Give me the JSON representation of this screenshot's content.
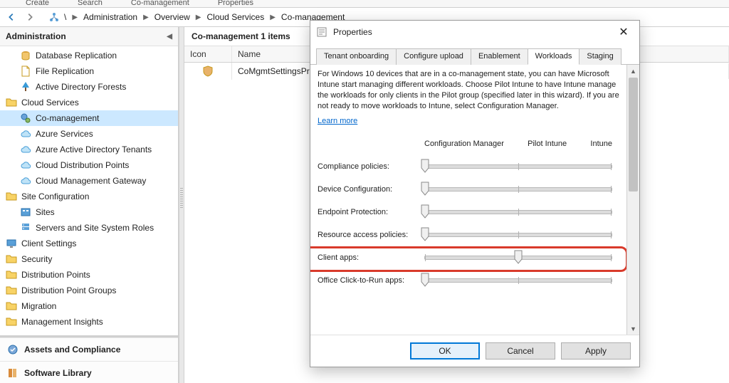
{
  "ribbon": {
    "items": [
      "Create",
      "Search",
      "Co-management",
      "Properties"
    ]
  },
  "breadcrumb": {
    "root_sep": "\\",
    "nodes": [
      "Administration",
      "Overview",
      "Cloud Services",
      "Co-management"
    ]
  },
  "nav": {
    "header": "Administration",
    "tree": [
      {
        "icon": "db-repl",
        "label": "Database Replication",
        "indent": 1
      },
      {
        "icon": "file-repl",
        "label": "File Replication",
        "indent": 1
      },
      {
        "icon": "ad-forests",
        "label": "Active Directory Forests",
        "indent": 1
      },
      {
        "icon": "folder",
        "label": "Cloud Services",
        "indent": 0
      },
      {
        "icon": "co-mgmt",
        "label": "Co-management",
        "indent": 1,
        "selected": true
      },
      {
        "icon": "azure",
        "label": "Azure Services",
        "indent": 1
      },
      {
        "icon": "aad-tenant",
        "label": "Azure Active Directory Tenants",
        "indent": 1
      },
      {
        "icon": "cdp",
        "label": "Cloud Distribution Points",
        "indent": 1
      },
      {
        "icon": "cmg",
        "label": "Cloud Management Gateway",
        "indent": 1
      },
      {
        "icon": "folder",
        "label": "Site Configuration",
        "indent": 0
      },
      {
        "icon": "sites",
        "label": "Sites",
        "indent": 1
      },
      {
        "icon": "servers",
        "label": "Servers and Site System Roles",
        "indent": 1
      },
      {
        "icon": "client",
        "label": "Client Settings",
        "indent": 0
      },
      {
        "icon": "folder",
        "label": "Security",
        "indent": 0
      },
      {
        "icon": "folder",
        "label": "Distribution Points",
        "indent": 0
      },
      {
        "icon": "folder",
        "label": "Distribution Point Groups",
        "indent": 0
      },
      {
        "icon": "folder",
        "label": "Migration",
        "indent": 0
      },
      {
        "icon": "folder",
        "label": "Management Insights",
        "indent": 0
      }
    ],
    "workspaces": [
      {
        "icon": "assets",
        "label": "Assets and Compliance"
      },
      {
        "icon": "swlib",
        "label": "Software Library"
      }
    ]
  },
  "content": {
    "title": "Co-management 1 items",
    "columns": {
      "icon": "Icon",
      "name": "Name"
    },
    "rows": [
      {
        "icon": "co-mgmt-item",
        "name": "CoMgmtSettingsProd"
      }
    ]
  },
  "dialog": {
    "title": "Properties",
    "tabs": [
      "Tenant onboarding",
      "Configure upload",
      "Enablement",
      "Workloads",
      "Staging"
    ],
    "active_tab": 3,
    "description": "For Windows 10 devices that are in a co-management state, you can have Microsoft Intune start managing different workloads. Choose Pilot Intune to have Intune manage the workloads for only clients in the Pilot group (specified later in this wizard). If you are not ready to move workloads to Intune, select Configuration Manager.",
    "learn_more": "Learn more",
    "slider_headers": {
      "left": "Configuration Manager",
      "mid": "Pilot Intune",
      "right": "Intune"
    },
    "workloads": [
      {
        "label": "Compliance policies:",
        "position": "cm"
      },
      {
        "label": "Device Configuration:",
        "position": "cm"
      },
      {
        "label": "Endpoint Protection:",
        "position": "cm"
      },
      {
        "label": "Resource access policies:",
        "position": "cm"
      },
      {
        "label": "Client apps:",
        "position": "pilot",
        "highlight": true
      },
      {
        "label": "Office Click-to-Run apps:",
        "position": "cm"
      }
    ],
    "buttons": {
      "ok": "OK",
      "cancel": "Cancel",
      "apply": "Apply"
    }
  }
}
